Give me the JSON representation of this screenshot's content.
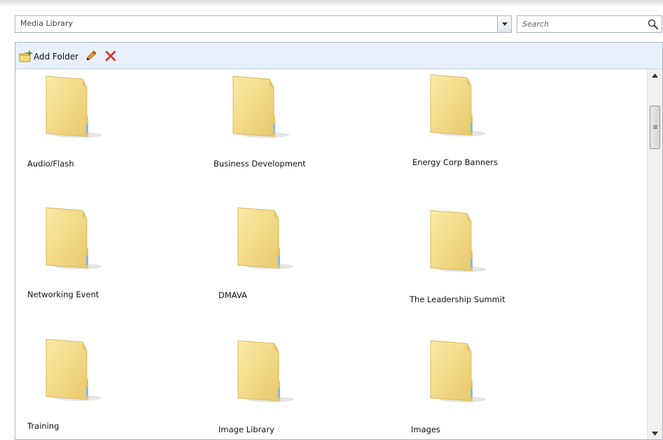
{
  "path": {
    "value": "Media Library"
  },
  "search": {
    "placeholder": "Search"
  },
  "toolbar": {
    "add_folder_label": "Add Folder"
  },
  "folders": [
    {
      "label": "Audio/Flash"
    },
    {
      "label": "Business Development"
    },
    {
      "label": "Energy Corp Banners"
    },
    {
      "label": "Networking Event"
    },
    {
      "label": "DMAVA"
    },
    {
      "label": "The Leadership Summit"
    },
    {
      "label": "Training"
    },
    {
      "label": "Image Library"
    },
    {
      "label": "Images"
    }
  ],
  "icons": {
    "folder": "folder-icon",
    "add_folder": "add-folder-icon",
    "edit": "pencil-icon",
    "delete": "red-x-icon",
    "search": "magnifier-icon",
    "dropdown": "chevron-down-icon"
  },
  "colors": {
    "toolbar_bg": "#e8f0fa",
    "border": "#a9b3c2",
    "folder_yellow": "#f3dc88",
    "delete_red": "#e0201a"
  }
}
